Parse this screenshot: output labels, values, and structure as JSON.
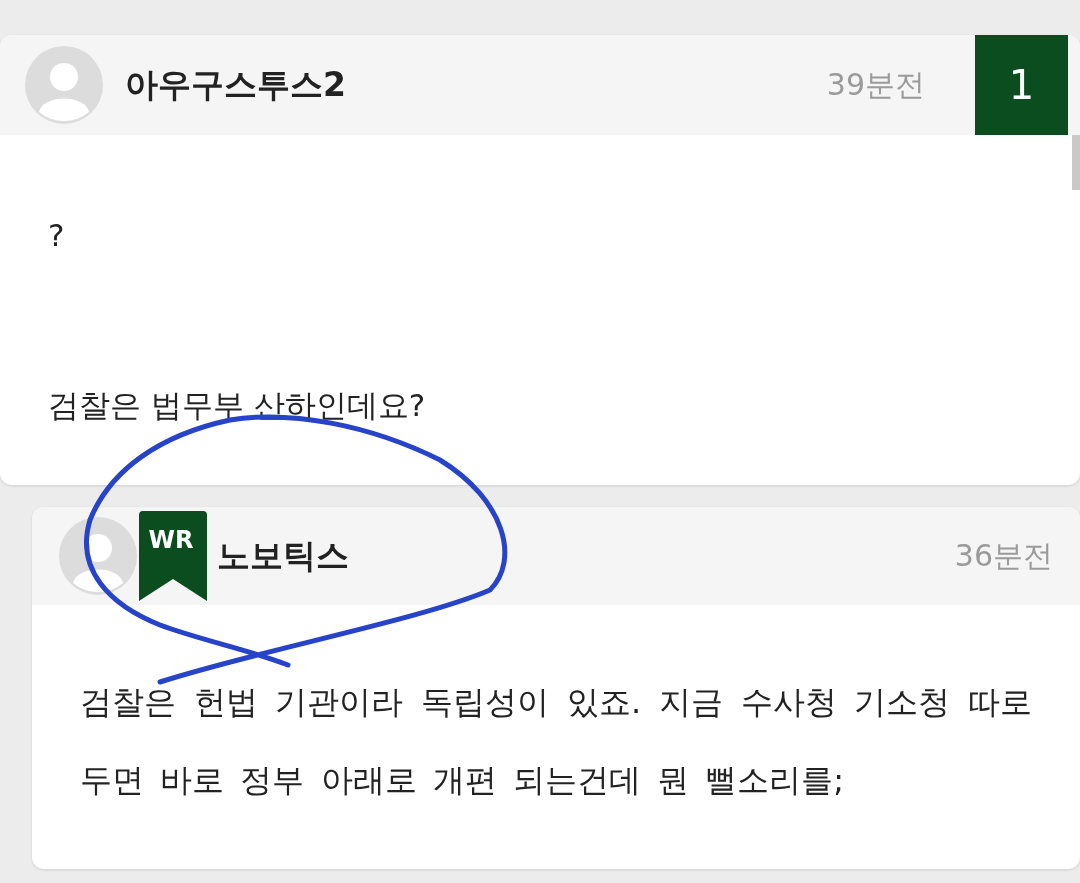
{
  "comments": [
    {
      "kind": "comment",
      "author": "아우구스투스2",
      "time": "39분전",
      "number": "1",
      "paragraphs": [
        "?",
        "검찰은 법무부 산하인데요?"
      ]
    },
    {
      "kind": "reply",
      "author": "노보틱스",
      "badge": "WR",
      "time": "36분전",
      "paragraphs": [
        "검찰은 헌법 기관이라 독립성이 있죠. 지금 수사청 기소청 따로 두면 바로 정부 아래로 개편 되는건데 뭔 뻘소리를;"
      ]
    }
  ]
}
